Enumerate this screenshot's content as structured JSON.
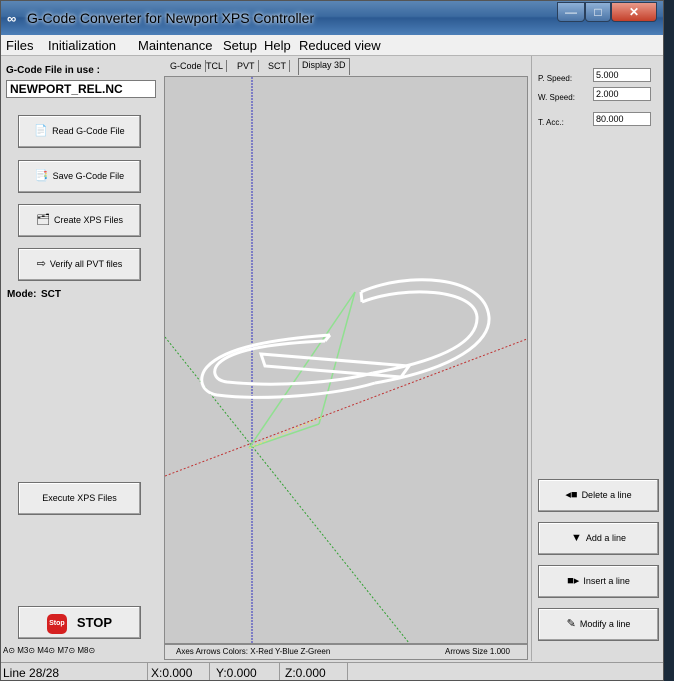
{
  "window": {
    "title": "G-Code Converter for Newport XPS Controller",
    "app_icon": "infinity-icon",
    "min_glyph": "—",
    "max_glyph": "□",
    "close_glyph": "✕"
  },
  "menu": [
    "Files",
    "Initialization",
    "Maintenance",
    "Setup",
    "Help",
    "Reduced view"
  ],
  "left": {
    "file_label": "G-Code File in use :",
    "file_name": "NEWPORT_REL.NC",
    "read_btn": "Read G-Code File",
    "save_btn": "Save G-Code File",
    "create_btn": "Create XPS Files",
    "verify_btn": "Verify all PVT files",
    "mode_label": "Mode:",
    "mode_value": "SCT",
    "execute_btn": "Execute XPS Files",
    "stop_icon_text": "Stop",
    "stop_label": "STOP",
    "indicators": "A⊙  M3⊙ M4⊙ M7⊙ M8⊙"
  },
  "tabs": [
    "G-Code",
    "TCL",
    "PVT",
    "SCT",
    "Display 3D"
  ],
  "active_tab": "Display 3D",
  "legend": {
    "axes_colors": "Axes Arrows Colors:  X-Red  Y-Blue  Z-Green",
    "arrows_size": "Arrows Size 1.000"
  },
  "right": {
    "p_speed_label": "P. Speed:",
    "p_speed": "5.000",
    "w_speed_label": "W. Speed:",
    "w_speed": "2.000",
    "t_acc_label": "T. Acc.:",
    "t_acc": "80.000",
    "delete_btn": "Delete a line",
    "add_btn": "Add a line",
    "insert_btn": "Insert a line",
    "modify_btn": "Modify a line"
  },
  "status": {
    "line": "Line 28/28",
    "x": "X:0.000",
    "y": "Y:0.000",
    "z": "Z:0.000"
  },
  "colors": {
    "x_axis": "#c03030",
    "y_axis": "#3030c0",
    "z_axis": "#30a030",
    "path": "#ffffff",
    "rapid": "#90e090"
  }
}
